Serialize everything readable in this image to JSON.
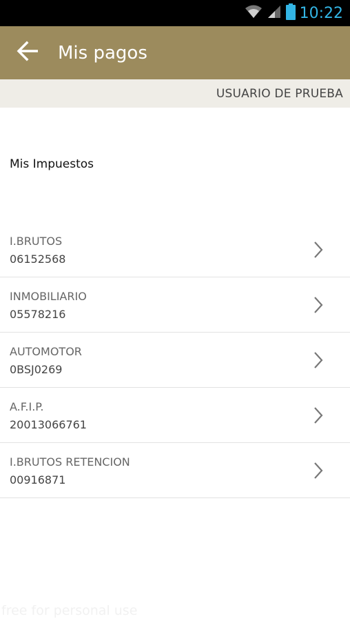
{
  "status_bar": {
    "time": "10:22",
    "icons": [
      "wifi-icon",
      "signal-icon",
      "battery-icon"
    ]
  },
  "app_bar": {
    "title": "Mis pagos",
    "back_icon": "arrow-left-icon",
    "color": "#9c8b5d"
  },
  "user_bar": {
    "user_name": "USUARIO DE PRUEBA"
  },
  "section": {
    "title": "Mis Impuestos"
  },
  "taxes": [
    {
      "name": "I.BRUTOS",
      "id": "06152568"
    },
    {
      "name": "INMOBILIARIO",
      "id": "05578216"
    },
    {
      "name": "AUTOMOTOR",
      "id": "0BSJ0269"
    },
    {
      "name": "A.F.I.P.",
      "id": "20013066761"
    },
    {
      "name": "I.BRUTOS RETENCION",
      "id": "00916871"
    }
  ],
  "watermark": "free for personal use"
}
